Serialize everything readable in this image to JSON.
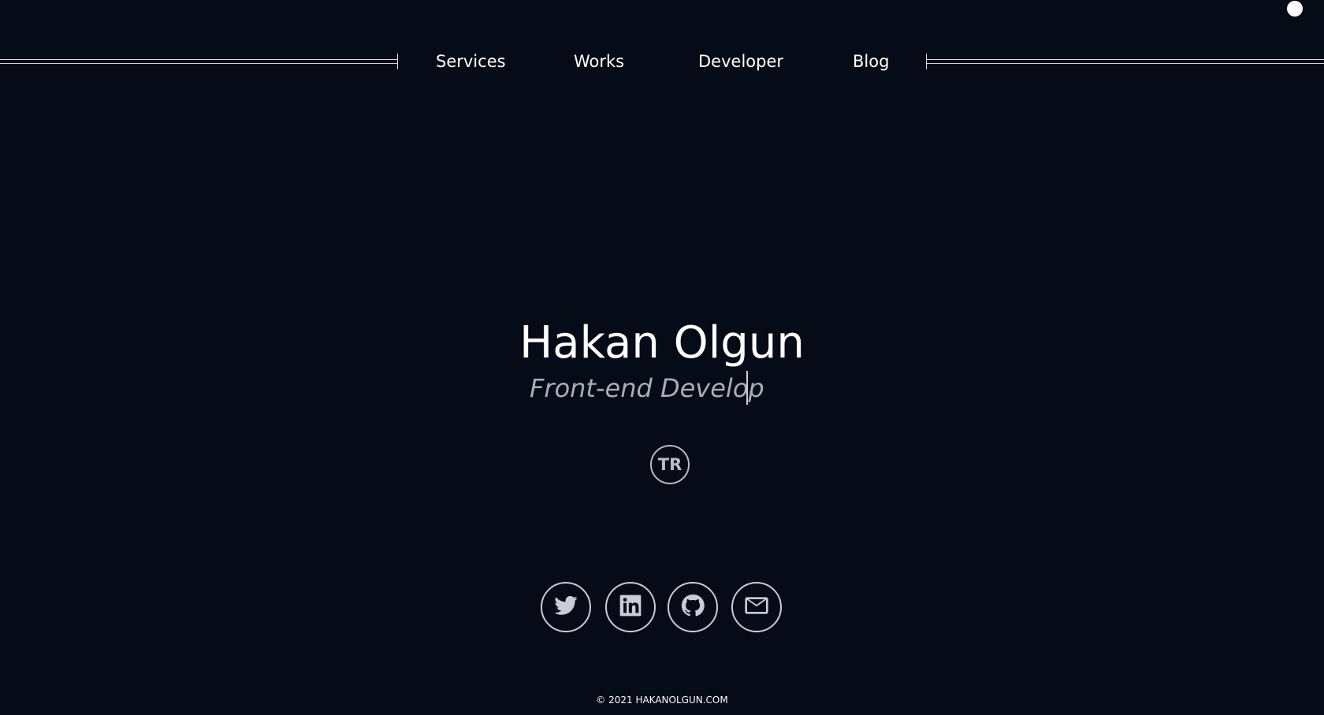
{
  "nav": {
    "items": [
      {
        "label": "Services"
      },
      {
        "label": "Works"
      },
      {
        "label": "Developer"
      },
      {
        "label": "Blog"
      }
    ]
  },
  "hero": {
    "name": "Hakan Olgun",
    "role_typed": "Front-end Develop"
  },
  "language_toggle": {
    "label": "TR"
  },
  "social": {
    "icons": [
      "twitter-icon",
      "linkedin-icon",
      "github-icon",
      "mail-icon"
    ]
  },
  "footer": {
    "copyright": "© 2021 HAKANOLGUN.COM"
  },
  "colors": {
    "background": "#050b17",
    "text": "#ffffff",
    "muted": "#a7adbb",
    "outline": "#c9cdd5"
  }
}
